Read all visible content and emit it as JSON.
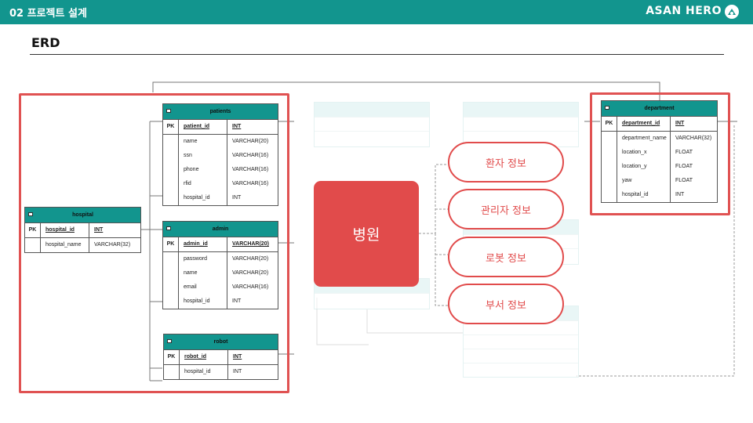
{
  "header": {
    "section": "02 프로젝트 설계",
    "brand": "ASAN HERO"
  },
  "page_title": "ERD",
  "tables": {
    "patients": {
      "name": "patients",
      "pk": {
        "key": "PK",
        "field": "patient_id",
        "type": "INT"
      },
      "fields": [
        {
          "field": "name",
          "type": "VARCHAR(20)"
        },
        {
          "field": "ssn",
          "type": "VARCHAR(16)"
        },
        {
          "field": "phone",
          "type": "VARCHAR(16)"
        },
        {
          "field": "rfid",
          "type": "VARCHAR(16)"
        },
        {
          "field": "hospital_id",
          "type": "INT"
        }
      ]
    },
    "hospital": {
      "name": "hospital",
      "pk": {
        "key": "PK",
        "field": "hospital_id",
        "type": "INT"
      },
      "fields": [
        {
          "field": "hospital_name",
          "type": "VARCHAR(32)"
        }
      ]
    },
    "admin": {
      "name": "admin",
      "pk": {
        "key": "PK",
        "field": "admin_id",
        "type": "VARCHAR(20)"
      },
      "fields": [
        {
          "field": "password",
          "type": "VARCHAR(20)"
        },
        {
          "field": "name",
          "type": "VARCHAR(20)"
        },
        {
          "field": "email",
          "type": "VARCHAR(16)"
        },
        {
          "field": "hospital_id",
          "type": "INT"
        }
      ]
    },
    "robot": {
      "name": "robot",
      "pk": {
        "key": "PK",
        "field": "robot_id",
        "type": "INT"
      },
      "fields": [
        {
          "field": "hospital_id",
          "type": "INT"
        }
      ]
    },
    "department": {
      "name": "department",
      "pk": {
        "key": "PK",
        "field": "department_id",
        "type": "INT"
      },
      "fields": [
        {
          "field": "department_name",
          "type": "VARCHAR(32)"
        },
        {
          "field": "location_x",
          "type": "FLOAT"
        },
        {
          "field": "location_y",
          "type": "FLOAT"
        },
        {
          "field": "yaw",
          "type": "FLOAT"
        },
        {
          "field": "hospital_id",
          "type": "INT"
        }
      ]
    }
  },
  "hub": {
    "label": "병원"
  },
  "categories": [
    "환자 정보",
    "관리자 정보",
    "로봇 정보",
    "부서 정보"
  ],
  "colors": {
    "teal": "#12958e",
    "highlight": "#e05252",
    "hub": "#e14b4b"
  }
}
